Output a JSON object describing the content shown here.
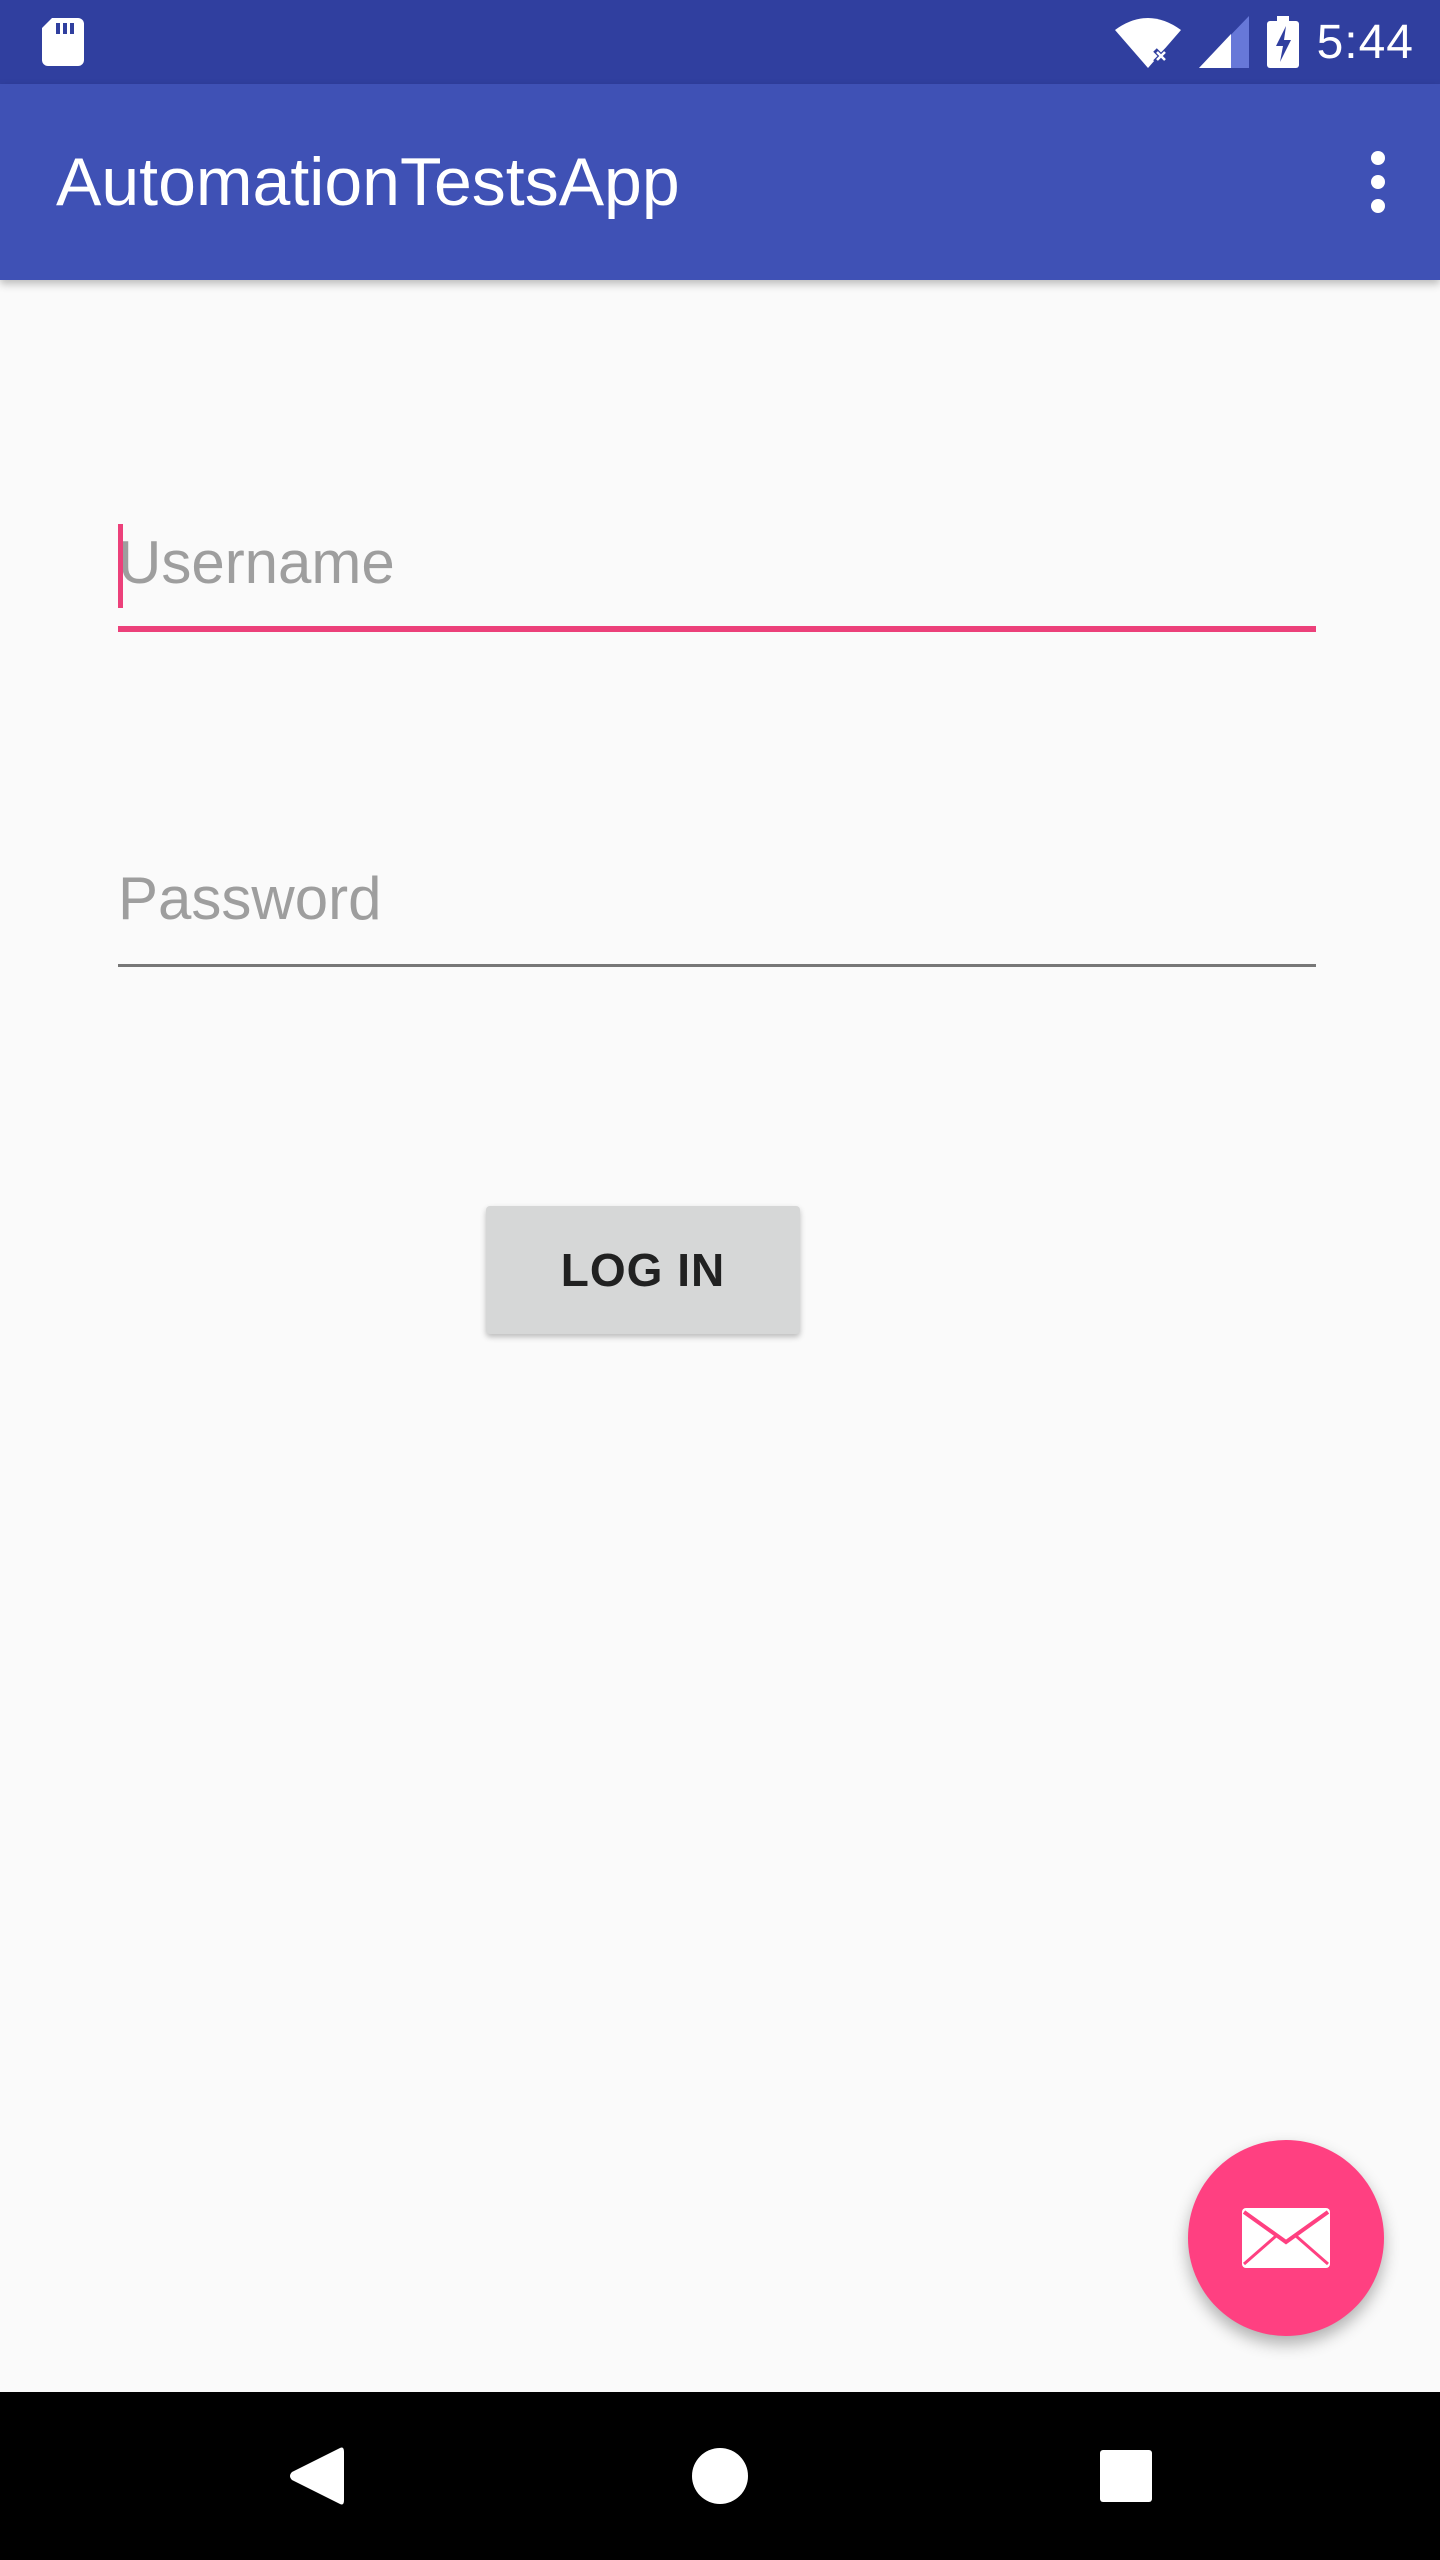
{
  "status_bar": {
    "time": "5:44",
    "icons": [
      "sd-card-icon",
      "wifi-icon",
      "cell-signal-icon",
      "battery-charging-icon"
    ],
    "background": "#303f9f"
  },
  "app_bar": {
    "title": "AutomationTestsApp",
    "overflow_icon": "more-vert-icon",
    "background": "#3f51b5"
  },
  "form": {
    "username": {
      "value": "",
      "placeholder": "Username",
      "focused": true
    },
    "password": {
      "value": "",
      "placeholder": "Password"
    },
    "login_label": "LOG IN"
  },
  "fab": {
    "icon": "mail-icon",
    "color": "#ff4081"
  },
  "accent_color": "#ec407a",
  "nav_bar": {
    "icons": [
      "back-icon",
      "home-icon",
      "recents-icon"
    ]
  }
}
